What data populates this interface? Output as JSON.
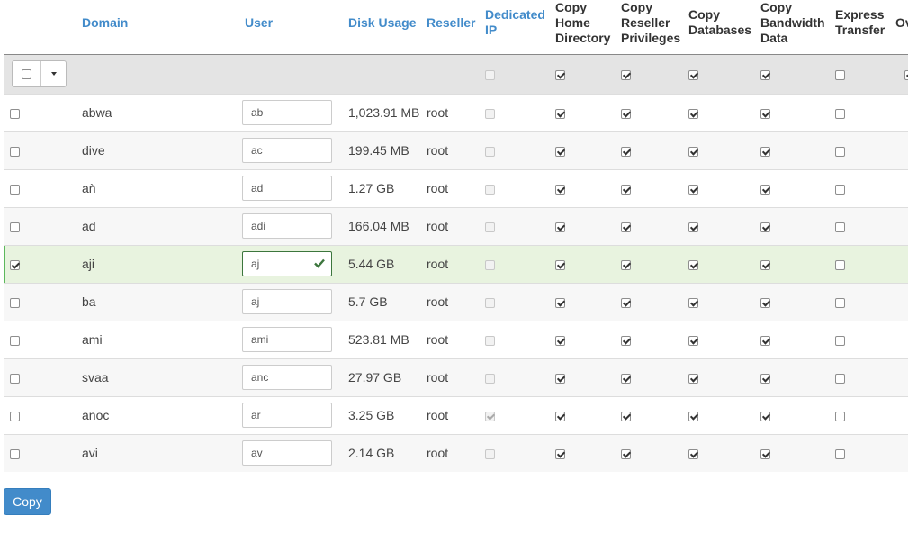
{
  "columns": {
    "domain": "Domain",
    "user": "User",
    "disk_usage": "Disk Usage",
    "reseller": "Reseller",
    "dedicated_ip_1": "Dedicated",
    "dedicated_ip_2": "IP",
    "home_1": "Copy",
    "home_2": "Home",
    "home_3": "Directory",
    "resp_1": "Copy",
    "resp_2": "Reseller",
    "resp_3": "Privileges",
    "db_1": "Copy",
    "db_2": "Databases",
    "bw_1": "Copy",
    "bw_2": "Bandwidth",
    "bw_3": "Data",
    "exp_1": "Express",
    "exp_2": "Transfer",
    "ov": "Ov"
  },
  "rows": [
    {
      "domain": "abwa",
      "user": "ab",
      "disk": "1,023.91 MB",
      "reseller": "root"
    },
    {
      "domain": "dive",
      "user": "ac",
      "disk": "199.45 MB",
      "reseller": "root"
    },
    {
      "domain": "aǹ",
      "user": "ad",
      "disk": "1.27 GB",
      "reseller": "root"
    },
    {
      "domain": "ad",
      "user": "adi",
      "disk": "166.04 MB",
      "reseller": "root"
    },
    {
      "domain": "aji",
      "user": "aj",
      "disk": "5.44 GB",
      "reseller": "root"
    },
    {
      "domain": "ba",
      "user": "aj",
      "disk": "5.7 GB",
      "reseller": "root"
    },
    {
      "domain": "ami",
      "user": "ami",
      "disk": "523.81 MB",
      "reseller": "root"
    },
    {
      "domain": "svaa",
      "user": "anc",
      "disk": "27.97 GB",
      "reseller": "root"
    },
    {
      "domain": "anoc",
      "user": "ar",
      "disk": "3.25 GB",
      "reseller": "root"
    },
    {
      "domain": "avi",
      "user": "av",
      "disk": "2.14 GB",
      "reseller": "root"
    }
  ],
  "copy_button": "Copy"
}
